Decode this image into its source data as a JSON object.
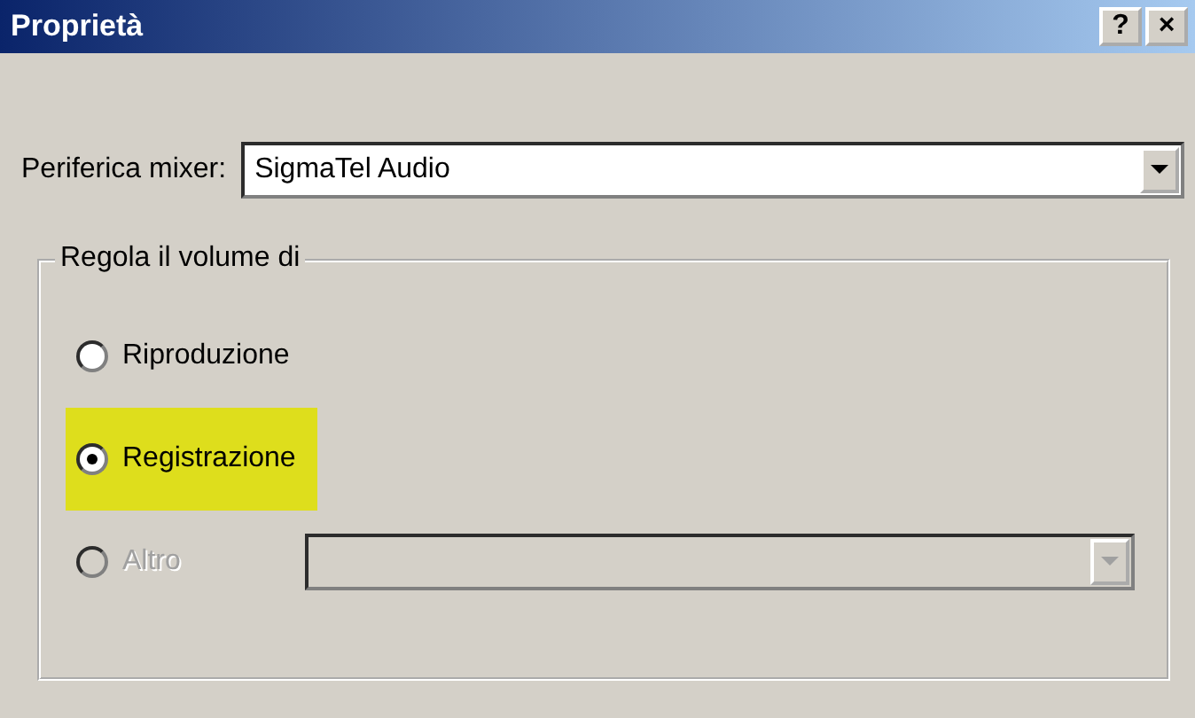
{
  "window": {
    "title": "Proprietà",
    "buttons": [
      "?",
      "×"
    ]
  },
  "mixer_device": {
    "label": "Periferica mixer:",
    "value": "SigmaTel Audio"
  },
  "volume_group": {
    "legend": "Regola il volume di",
    "options": [
      {
        "label": "Riproduzione",
        "selected": false,
        "disabled": false,
        "highlighted": false
      },
      {
        "label": "Registrazione",
        "selected": true,
        "disabled": false,
        "highlighted": true
      },
      {
        "label": "Altro",
        "selected": false,
        "disabled": true,
        "highlighted": false
      }
    ]
  },
  "other_device": {
    "disabled": true
  }
}
